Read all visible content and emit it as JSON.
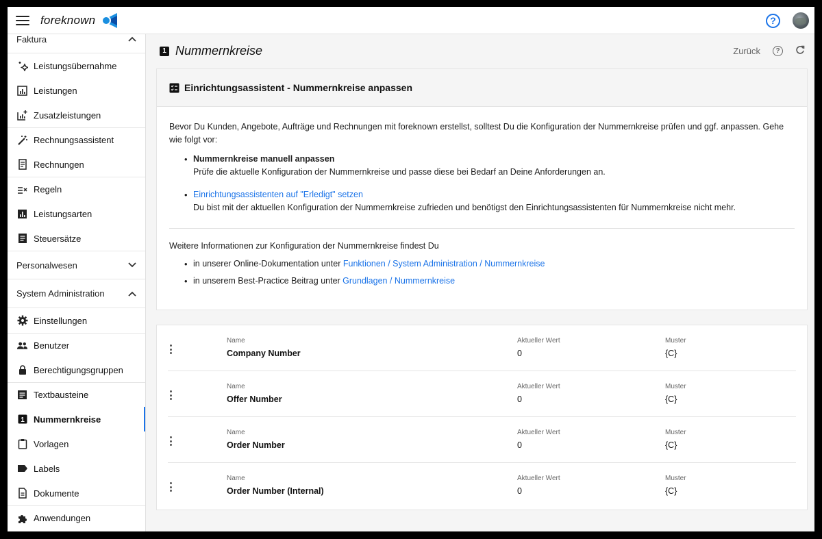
{
  "app": {
    "brand": "foreknown"
  },
  "sidebar": {
    "sections": [
      {
        "label": "Faktura"
      },
      {
        "label": "Personalwesen"
      },
      {
        "label": "System Administration"
      }
    ],
    "faktura_items": [
      {
        "label": "Leistungsübernahme",
        "icon": "sparkle-icon"
      },
      {
        "label": "Leistungen",
        "icon": "bar-chart-icon"
      },
      {
        "label": "Zusatzleistungen",
        "icon": "bar-chart-plus-icon"
      },
      {
        "label": "Rechnungsassistent",
        "icon": "magic-wand-icon"
      },
      {
        "label": "Rechnungen",
        "icon": "receipt-icon"
      },
      {
        "label": "Regeln",
        "icon": "rule-icon"
      },
      {
        "label": "Leistungsarten",
        "icon": "chart-box-icon"
      },
      {
        "label": "Steuersätze",
        "icon": "document-icon"
      }
    ],
    "admin_items": [
      {
        "label": "Einstellungen",
        "icon": "gear-icon"
      },
      {
        "label": "Benutzer",
        "icon": "users-icon"
      },
      {
        "label": "Berechtigungsgruppen",
        "icon": "lock-icon"
      },
      {
        "label": "Textbausteine",
        "icon": "text-box-icon"
      },
      {
        "label": "Nummernkreise",
        "icon": "number-box-icon",
        "active": true
      },
      {
        "label": "Vorlagen",
        "icon": "clipboard-icon"
      },
      {
        "label": "Labels",
        "icon": "label-icon"
      },
      {
        "label": "Dokumente",
        "icon": "file-icon"
      },
      {
        "label": "Anwendungen",
        "icon": "puzzle-icon"
      }
    ]
  },
  "page": {
    "icon_char": "1",
    "title": "Nummernkreise",
    "back_label": "Zurück"
  },
  "info": {
    "heading": "Einrichtungsassistent - Nummernkreise anpassen",
    "intro": "Bevor Du Kunden, Angebote, Aufträge und Rechnungen mit foreknown erstellst, solltest Du die Konfiguration der Nummernkreise prüfen und ggf. anpassen. Gehe wie folgt vor:",
    "step1_title": "Nummernkreise manuell anpassen",
    "step1_text": "Prüfe die aktuelle Konfiguration der Nummernkreise und passe diese bei Bedarf an Deine Anforderungen an.",
    "step2_link": "Einrichtungsassistenten auf \"Erledigt\" setzen",
    "step2_text": "Du bist mit der aktuellen Konfiguration der Nummernkreise zufrieden und benötigst den Einrichtungsassistenten für Nummernkreise nicht mehr.",
    "more_info": "Weitere Informationen zur Konfiguration der Nummernkreise findest Du",
    "doc_prefix": "in unserer Online-Dokumentation unter ",
    "doc_link": "Funktionen / System Administration / Nummernkreise",
    "bp_prefix": "in unserem Best-Practice Beitrag unter ",
    "bp_link": "Grundlagen / Nummernkreise"
  },
  "table": {
    "col_name": "Name",
    "col_value": "Aktueller Wert",
    "col_pattern": "Muster",
    "rows": [
      {
        "name": "Company Number",
        "value": "0",
        "pattern": "{C}"
      },
      {
        "name": "Offer Number",
        "value": "0",
        "pattern": "{C}"
      },
      {
        "name": "Order Number",
        "value": "0",
        "pattern": "{C}"
      },
      {
        "name": "Order Number (Internal)",
        "value": "0",
        "pattern": "{C}"
      }
    ]
  }
}
